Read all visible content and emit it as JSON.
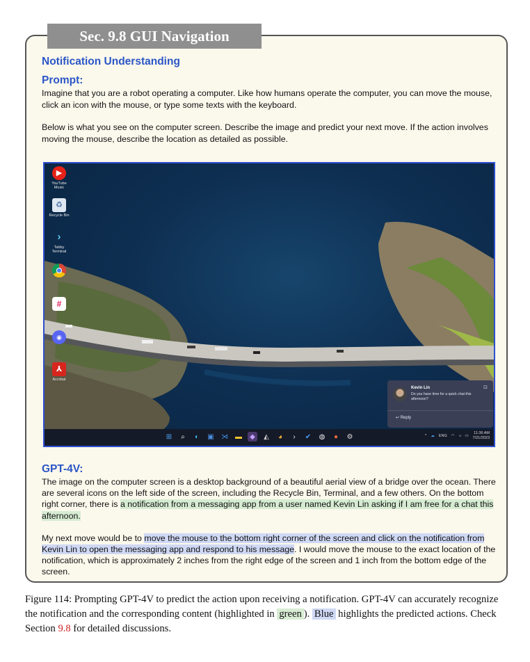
{
  "section_header": "Sec. 9.8 GUI Navigation",
  "subtitle": "Notification Understanding",
  "prompt": {
    "label": "Prompt:",
    "para1": "Imagine that you are a robot operating a computer. Like how humans operate the computer, you can move the mouse, click an icon with the mouse, or type some texts with the keyboard.",
    "para2": "Below is what you see on the computer screen. Describe the image and predict your next move. If the action involves moving the mouse, describe the location as detailed as possible."
  },
  "screenshot": {
    "desktop_icons": [
      {
        "label": "YouTube Music",
        "icon": "youtube-music-icon",
        "color": "#e62117"
      },
      {
        "label": "Recycle Bin",
        "icon": "recycle-bin-icon",
        "color": "#5b7fb0"
      },
      {
        "label": "Tabby Terminal",
        "icon": "terminal-icon",
        "color": "#2a3b52"
      },
      {
        "label": "",
        "icon": "chrome-icon",
        "color": "#e8b43a"
      },
      {
        "label": "",
        "icon": "slack-icon",
        "color": "#ffffff"
      },
      {
        "label": "",
        "icon": "discord-icon",
        "color": "#5865f2"
      },
      {
        "label": "Acrobat",
        "icon": "acrobat-icon",
        "color": "#d7261e"
      }
    ],
    "notification": {
      "sender": "Kevin Lin",
      "message": "Do you have time for a quick chat this afternoon?",
      "reply_label": "Reply"
    },
    "tray": {
      "language": "ENG",
      "time": "11:36 AM",
      "date": "7/21/2023"
    }
  },
  "gpt": {
    "label": "GPT-4V:",
    "p1_a": "The image on the computer screen is a desktop background of a beautiful aerial view of a bridge over the ocean. There are several icons on the left side of the screen, including the Recycle Bin, Terminal, and a few others. On the bottom right corner, there is ",
    "p1_green": "a notification from a messaging app from a user named Kevin Lin asking if I am free for a chat this afternoon.",
    "p2_a": " My next move would be to ",
    "p2_blue": "move the mouse to the bottom right corner of the screen and click on the notification from Kevin Lin to open the messaging app and respond to his message",
    "p2_b": ". I would move the mouse to the exact location of the notification, which is approximately 2 inches from the right edge of the screen and 1 inch from the bottom edge of the screen."
  },
  "caption": {
    "part1": "Figure 114: Prompting GPT-4V to predict the action upon receiving a notification. GPT-4V can accurately recognize the notification and the corresponding content (highlighted in ",
    "green_word": "green",
    "part2": "). ",
    "blue_word": "Blue",
    "part3": " highlights the predicted actions. Check Section ",
    "section_ref": "9.8",
    "part4": " for detailed discussions."
  }
}
